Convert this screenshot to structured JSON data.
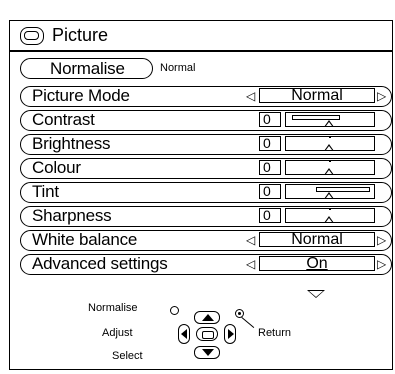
{
  "window": {
    "title": "Picture",
    "icon": "picture-menu-icon"
  },
  "normalise": {
    "label": "Normalise",
    "status": "Normal"
  },
  "rows": [
    {
      "label": "Picture Mode",
      "kind": "select",
      "value": "Normal"
    },
    {
      "label": "Contrast",
      "kind": "slider",
      "value": "0",
      "level": 0
    },
    {
      "label": "Brightness",
      "kind": "slider",
      "value": "0",
      "level": 0
    },
    {
      "label": "Colour",
      "kind": "slider",
      "value": "0",
      "level": 0
    },
    {
      "label": "Tint",
      "kind": "slider",
      "value": "0",
      "level": 0
    },
    {
      "label": "Sharpness",
      "kind": "slider",
      "value": "0",
      "level": 0
    },
    {
      "label": "White balance",
      "kind": "select",
      "value": "Normal"
    },
    {
      "label": "Advanced settings",
      "kind": "select",
      "value": "On"
    }
  ],
  "legend": {
    "normalise": "Normalise",
    "adjust": "Adjust",
    "select": "Select",
    "return": "Return"
  },
  "arrows": {
    "left": "◁",
    "right": "▷"
  },
  "colors": {
    "background": "#ffffff",
    "foreground": "#000000"
  }
}
